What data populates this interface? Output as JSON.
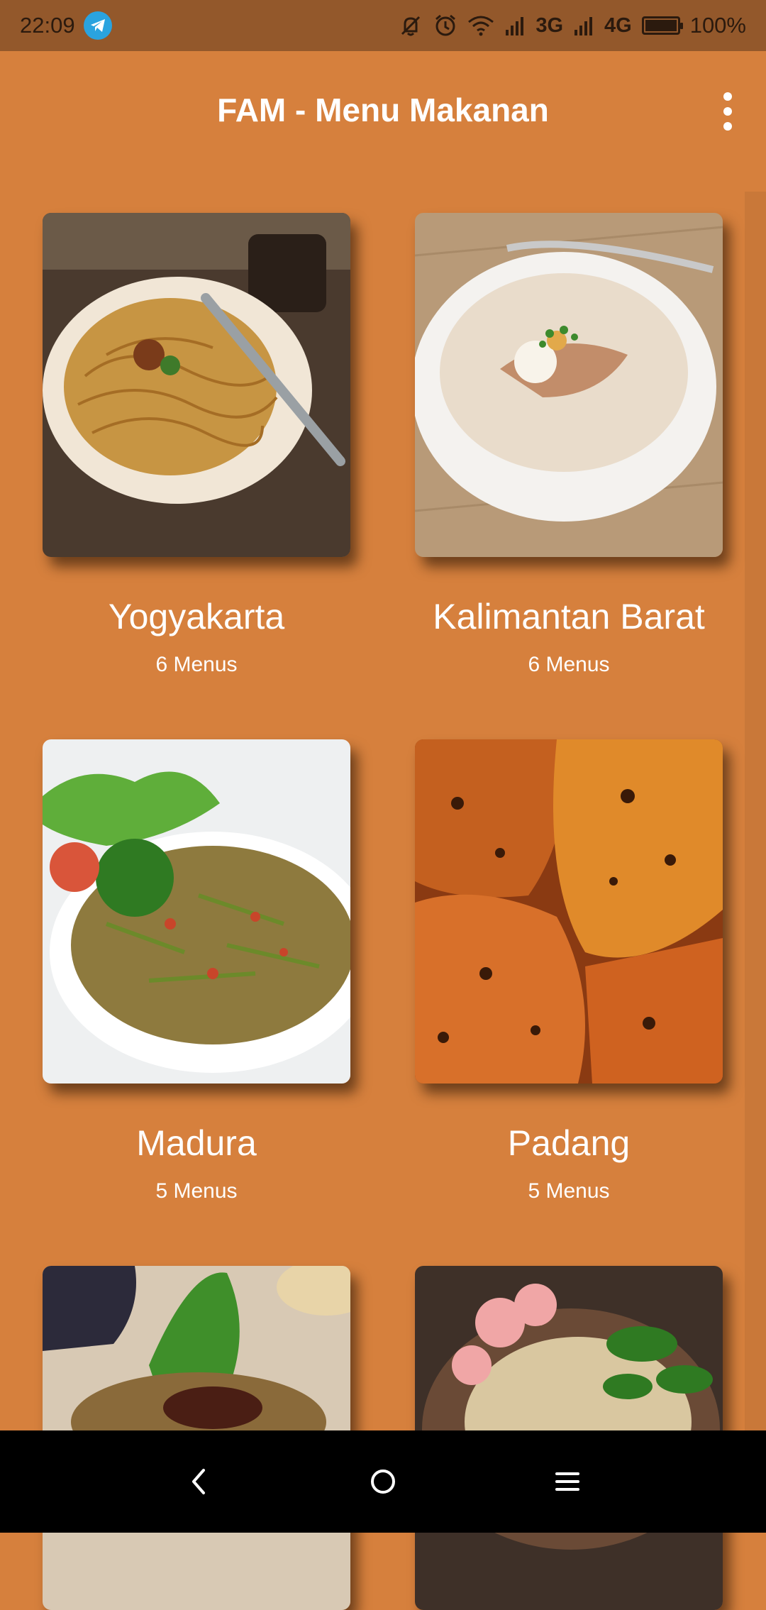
{
  "status_bar": {
    "time": "22:09",
    "network_1": "3G",
    "network_2": "4G",
    "battery_text": "100%",
    "battery_level": 1.0,
    "icons": [
      "telegram-icon",
      "mute-icon",
      "alarm-icon",
      "wifi-icon",
      "signal-icon",
      "signal-icon",
      "battery-icon"
    ]
  },
  "app_bar": {
    "title": "FAM - Menu Makanan",
    "overflow_icon": "more-vert-icon"
  },
  "regions": [
    {
      "name": "Yogyakarta",
      "count": "6 Menus",
      "image": "noodle-dish-photo"
    },
    {
      "name": "Kalimantan Barat",
      "count": "6 Menus",
      "image": "porridge-bowl-photo"
    },
    {
      "name": "Madura",
      "count": "5 Menus",
      "image": "stir-fried-salad-photo"
    },
    {
      "name": "Padang",
      "count": "5 Menus",
      "image": "grilled-chicken-photo"
    },
    {
      "name": "",
      "count": "",
      "image": "banana-leaf-dish-photo"
    },
    {
      "name": "",
      "count": "",
      "image": "crackers-salad-photo"
    }
  ],
  "nav_bar": {
    "icons": [
      "back-icon",
      "home-icon",
      "recents-icon"
    ]
  },
  "colors": {
    "background": "#D6803D",
    "status_bar": "#93582B",
    "nav_bar": "#000000",
    "text": "#FFFFFF"
  }
}
